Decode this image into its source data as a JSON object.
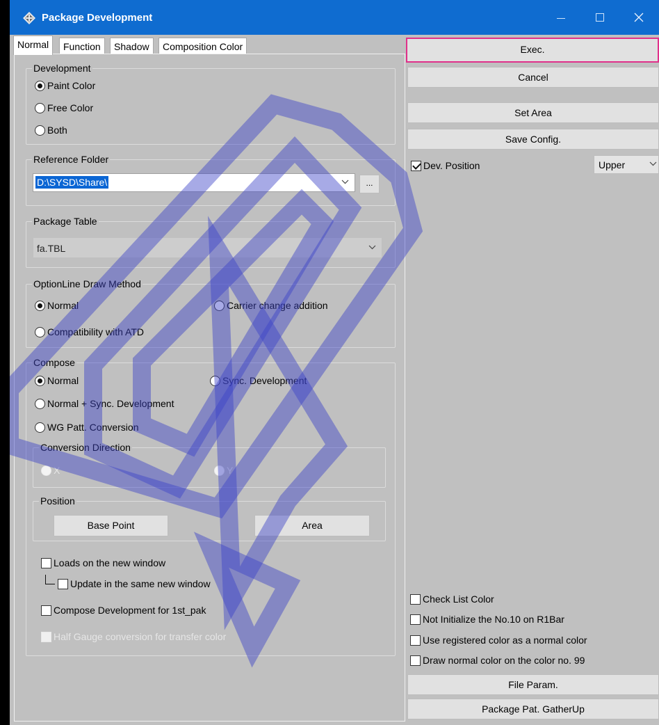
{
  "window": {
    "title": "Package Development"
  },
  "tabs": [
    "Normal",
    "Function",
    "Shadow",
    "Composition Color"
  ],
  "development": {
    "legend": "Development",
    "options": [
      "Paint Color",
      "Free Color",
      "Both"
    ]
  },
  "reference_folder": {
    "legend": "Reference Folder",
    "value": "D:\\SYSD\\Share\\",
    "browse": "..."
  },
  "package_table": {
    "legend": "Package Table",
    "value": "fa.TBL"
  },
  "optionline": {
    "legend": "OptionLine Draw Method",
    "normal": "Normal",
    "carrier": "Carrier change addition",
    "compat": "Compatibility with ATD"
  },
  "compose": {
    "legend": "Compose",
    "normal": "Normal",
    "sync": "Sync. Development",
    "normal_sync": "Normal + Sync. Development",
    "wg": "WG Patt. Conversion",
    "conv_legend": "Conversion Direction",
    "x": "X",
    "y": "Y",
    "pos_legend": "Position",
    "base_point": "Base Point",
    "area": "Area",
    "loads": "Loads on the new window",
    "update": "Update in the same new window",
    "compose_1st": "Compose Development for 1st_pak",
    "half_gauge": "Half Gauge conversion for transfer color"
  },
  "right": {
    "exec": "Exec.",
    "cancel": "Cancel",
    "set_area": "Set Area",
    "save_config": "Save Config.",
    "dev_position": "Dev. Position",
    "dev_position_value": "Upper",
    "check_list_color": "Check List Color",
    "not_init": "Not Initialize the No.10 on R1Bar",
    "use_registered": "Use registered color as a normal color",
    "draw_normal": "Draw normal color on the color no. 99",
    "file_param": "File Param.",
    "gather_up": "Package Pat. GatherUp"
  },
  "colors": {
    "titlebar": "#0f6cd0",
    "dialog": "#c0c0c0",
    "default_button_border": "#e0308a",
    "selection": "#0b66d4"
  },
  "icons": [
    "app-icon",
    "minimize-icon",
    "maximize-icon",
    "close-icon",
    "chevron-down-icon",
    "watermark-logo"
  ]
}
